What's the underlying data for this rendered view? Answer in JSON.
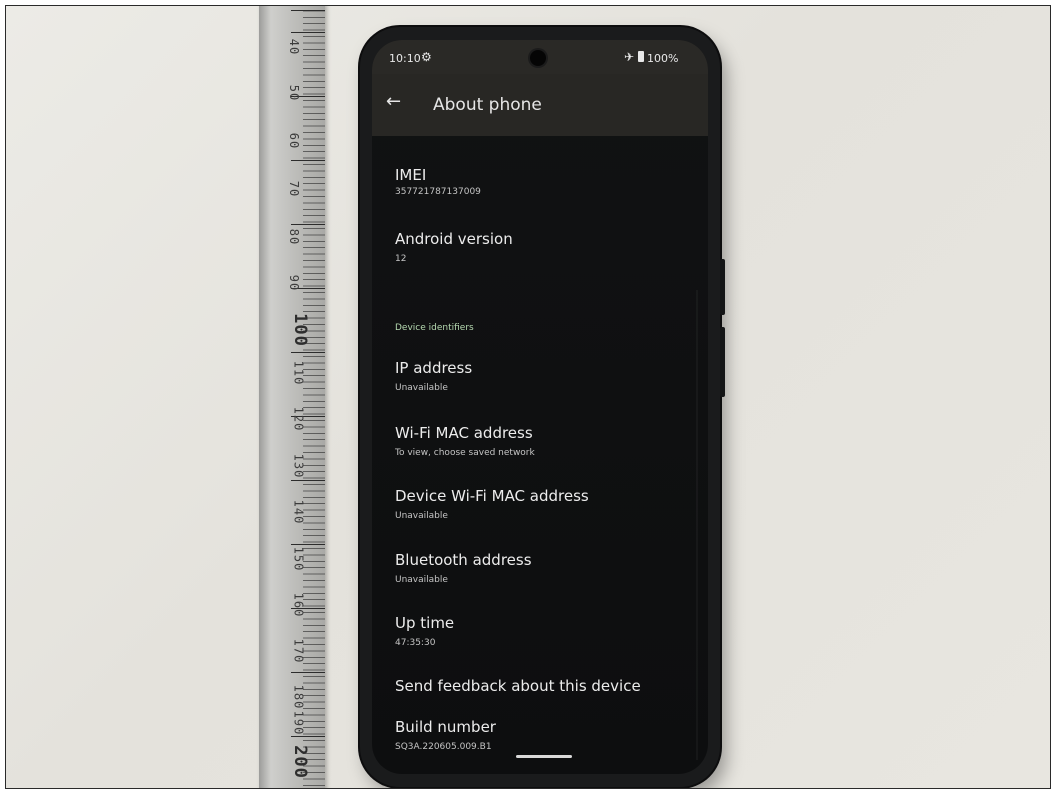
{
  "ruler": {
    "labels": [
      "40",
      "50",
      "60",
      "70",
      "80",
      "90",
      "100",
      "110",
      "120",
      "130",
      "140",
      "150",
      "160",
      "170",
      "180",
      "190",
      "200"
    ]
  },
  "status_bar": {
    "time": "10:10",
    "settings_icon": "gear-icon",
    "airplane_icon": "airplane-icon",
    "battery_icon": "battery-icon",
    "battery_percent": "100%"
  },
  "app_bar": {
    "back_icon": "arrow-left-icon",
    "title": "About phone"
  },
  "items": [
    {
      "title": "IMEI",
      "subtitle": "357721787137009"
    },
    {
      "title": "Android version",
      "subtitle": "12"
    }
  ],
  "section_header": "Device identifiers",
  "identifiers": [
    {
      "title": "IP address",
      "subtitle": "Unavailable"
    },
    {
      "title": "Wi-Fi MAC address",
      "subtitle": "To view, choose saved network"
    },
    {
      "title": "Device Wi-Fi MAC address",
      "subtitle": "Unavailable"
    },
    {
      "title": "Bluetooth address",
      "subtitle": "Unavailable"
    },
    {
      "title": "Up time",
      "subtitle": "47:35:30"
    },
    {
      "title": "Send feedback about this device"
    },
    {
      "title": "Build number",
      "subtitle": "SQ3A.220605.009.B1"
    }
  ]
}
